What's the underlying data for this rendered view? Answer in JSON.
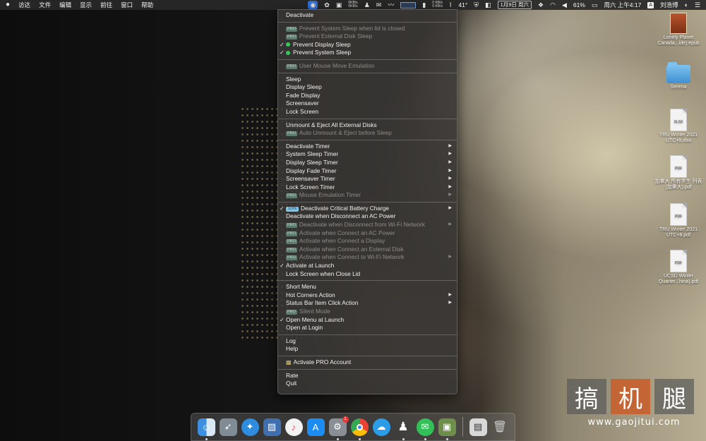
{
  "menubar": {
    "apple_icon": "",
    "app_menus": [
      "访达",
      "文件",
      "编辑",
      "显示",
      "前往",
      "窗口",
      "帮助"
    ],
    "netspeed_up": "0KB/s",
    "netspeed_down": "0KB/s",
    "netspeed2_up": "0 KB/s",
    "netspeed2_down": "0 KB/s",
    "temperature": "41°",
    "date_text": "1月9日 周六",
    "battery": "61%",
    "clock": "周六 上午4:17",
    "input_method": "A",
    "user_name": "刘浩博"
  },
  "menu": {
    "items": [
      {
        "id": "deactivate",
        "label": "Deactivate",
        "disabled": false
      },
      {
        "sep": true
      },
      {
        "id": "prevent-system-sleep-lid",
        "label": "Prevent System Sleep when lid is closed",
        "disabled": true,
        "pro": "PRO"
      },
      {
        "id": "prevent-external-disk-sleep",
        "label": "Prevent External Disk Sleep",
        "disabled": true,
        "pro": "PRO"
      },
      {
        "id": "prevent-display-sleep",
        "label": "Prevent Display Sleep",
        "checked": true,
        "dot": true
      },
      {
        "id": "prevent-system-sleep",
        "label": "Prevent System Sleep",
        "checked": true,
        "dot": true
      },
      {
        "sep": true
      },
      {
        "id": "user-mouse-move-emulation",
        "label": "User Mouse Move Emulation",
        "disabled": true,
        "pro": "PRO"
      },
      {
        "sep": true
      },
      {
        "id": "sleep",
        "label": "Sleep"
      },
      {
        "id": "display-sleep",
        "label": "Display Sleep"
      },
      {
        "id": "fade-display",
        "label": "Fade Display"
      },
      {
        "id": "screensaver",
        "label": "Screensaver"
      },
      {
        "id": "lock-screen",
        "label": "Lock Screen"
      },
      {
        "sep": true
      },
      {
        "id": "unmount-eject-all",
        "label": "Unmount & Eject All External Disks"
      },
      {
        "id": "auto-unmount-eject",
        "label": "Auto Unmount & Eject before Sleep",
        "disabled": true,
        "pro": "PRO"
      },
      {
        "sep": true
      },
      {
        "id": "deactivate-timer",
        "label": "Deactivate Timer",
        "submenu": true
      },
      {
        "id": "system-sleep-timer",
        "label": "System Sleep Timer",
        "submenu": true
      },
      {
        "id": "display-sleep-timer",
        "label": "Display Sleep Timer",
        "submenu": true
      },
      {
        "id": "display-fade-timer",
        "label": "Display Fade Timer",
        "submenu": true
      },
      {
        "id": "screensaver-timer",
        "label": "Screensaver Timer",
        "submenu": true
      },
      {
        "id": "lock-screen-timer",
        "label": "Lock Screen Timer",
        "submenu": true
      },
      {
        "id": "mouse-emulation-timer",
        "label": "Mouse Emulation Timer",
        "disabled": true,
        "pro": "PRO",
        "submenu": true
      },
      {
        "sep": true
      },
      {
        "id": "deactivate-critical-battery",
        "label": "Deactivate Critical Battery Charge",
        "checked": true,
        "pct": "10%",
        "submenu": true
      },
      {
        "id": "deactivate-disconnect-ac",
        "label": "Deactivate when Disconnect an AC Power"
      },
      {
        "id": "deactivate-disconnect-wifi",
        "label": "Deactivate when Disconnect from Wi-Fi Network",
        "disabled": true,
        "pro": "PRO",
        "submenu": true
      },
      {
        "id": "activate-connect-ac",
        "label": "Activate when Connect an AC Power",
        "disabled": true,
        "pro": "PRO"
      },
      {
        "id": "activate-connect-display",
        "label": "Activate when Connect a Display",
        "disabled": true,
        "pro": "PRO"
      },
      {
        "id": "activate-connect-external-disk",
        "label": "Activate when Connect an External Disk",
        "disabled": true,
        "pro": "PRO"
      },
      {
        "id": "activate-connect-wifi",
        "label": "Activate when Connect to Wi-Fi Network",
        "disabled": true,
        "pro": "PRO",
        "submenu": true
      },
      {
        "id": "activate-at-launch",
        "label": "Activate at Launch",
        "checked": true
      },
      {
        "id": "lock-screen-close-lid",
        "label": "Lock Screen when Close Lid"
      },
      {
        "sep": true
      },
      {
        "id": "short-menu",
        "label": "Short Menu"
      },
      {
        "id": "hot-corners-action",
        "label": "Hot Corners Action",
        "submenu": true
      },
      {
        "id": "status-bar-click-action",
        "label": "Status Bar Item Click Action",
        "submenu": true
      },
      {
        "id": "silent-mode",
        "label": "Silent Mode",
        "disabled": true,
        "pro": "PRO"
      },
      {
        "id": "open-menu-at-launch",
        "label": "Open Menu at Launch",
        "checked": true
      },
      {
        "id": "open-at-login",
        "label": "Open at Login"
      },
      {
        "sep": true
      },
      {
        "id": "log",
        "label": "Log"
      },
      {
        "id": "help",
        "label": "Help"
      },
      {
        "sep": true
      },
      {
        "id": "activate-pro-account",
        "label": "Activate PRO Account",
        "gift": true
      },
      {
        "sep": true
      },
      {
        "id": "rate",
        "label": "Rate"
      },
      {
        "id": "quit",
        "label": "Quit"
      }
    ]
  },
  "desktop": {
    "items": [
      {
        "name": "book",
        "label": "Lonely Planet Canada...ide).epub",
        "icon": "book-icon"
      },
      {
        "name": "folder",
        "label": "Serena",
        "icon": "folder-icon"
      },
      {
        "name": "doc1",
        "label": "TRU Winter 2021 UTC+8.xlsx",
        "icon": "doc-icon",
        "tag": "XLSX"
      },
      {
        "name": "doc2",
        "label": "加拿大 所有学生 列表(加拿大).pdf",
        "icon": "doc-icon",
        "tag": "PDF"
      },
      {
        "name": "doc3",
        "label": "TRU Winter 2021 UTC+8.pdf",
        "icon": "doc-icon",
        "tag": "PDF"
      },
      {
        "name": "doc4",
        "label": "UCSD Winter Quarter...hina).pdf",
        "icon": "doc-icon",
        "tag": "PDF"
      }
    ]
  },
  "dock": {
    "trash_badge": "1"
  },
  "watermark": {
    "chars": [
      "搞",
      "机",
      "腿"
    ],
    "url": "www.gaojitui.com"
  }
}
